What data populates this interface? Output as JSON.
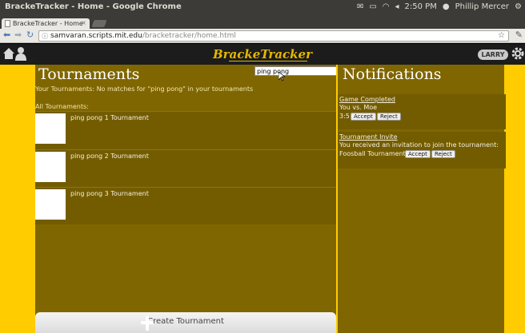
{
  "os": {
    "window_title": "BrackeTracker - Home - Google Chrome",
    "clock": "2:50 PM",
    "user_name": "Phillip Mercer"
  },
  "browser": {
    "tab_title": "BrackeTracker - Home",
    "tab_close": "×",
    "url_host": "samvaran.scripts.mit.edu",
    "url_path": "/bracketracker/home.html"
  },
  "app": {
    "brand": "BrackeTracker",
    "user_pill": "LARRY"
  },
  "tournaments": {
    "title": "Tournaments",
    "search_value": "ping pong",
    "your_tournaments_msg": "Your Tournaments: No matches for \"ping pong\" in your tournaments",
    "all_label": "All Tournaments:",
    "items": [
      {
        "name": "ping pong 1 Tournament"
      },
      {
        "name": "ping pong 2 Tournament"
      },
      {
        "name": "ping pong 3 Tournament"
      }
    ],
    "create_label": "Create Tournament"
  },
  "notifications": {
    "title": "Notifications",
    "items": [
      {
        "heading": "Game Completed",
        "line1": "You vs. Moe",
        "line2": "3:5",
        "accept": "Accept",
        "reject": "Reject"
      },
      {
        "heading": "Tournament Invite",
        "line1": "You received an invitation to join the tournament:",
        "line2": "Foosball Tournament",
        "accept": "Accept",
        "reject": "Reject"
      }
    ]
  },
  "colors": {
    "accent_yellow": "#ffcc00",
    "panel_olive": "#806600",
    "header_dark": "#1c1c1c"
  }
}
